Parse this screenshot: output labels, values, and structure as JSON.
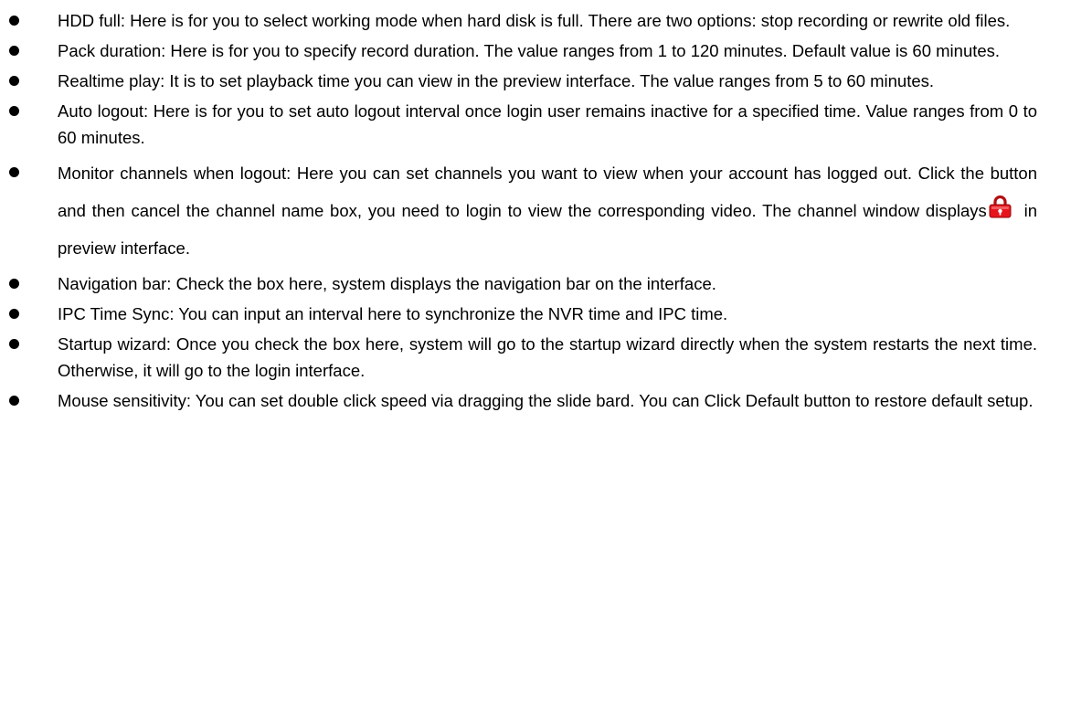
{
  "items": [
    {
      "name": "hdd-full",
      "text": "HDD full: Here is for you to select working mode when hard disk is full. There are two options: stop recording or rewrite old files."
    },
    {
      "name": "pack-duration",
      "text": "Pack duration: Here is for you to specify record duration. The value ranges from 1 to 120 minutes. Default value is 60 minutes."
    },
    {
      "name": "realtime-play",
      "text": "Realtime play: It is to set playback time you can view in the preview interface. The value ranges from 5 to 60 minutes."
    },
    {
      "name": "auto-logout",
      "text": "Auto logout: Here is for you to set auto logout interval once login user remains inactive for a specified time. Value ranges from 0 to 60 minutes."
    },
    {
      "name": "monitor-channels",
      "text_before_icon": "Monitor channels when logout: Here you can set channels you want to view when your account has logged out. Click the button and then cancel the channel name box, you need to login to view the corresponding video. The channel window displays",
      "icon": "lock-icon",
      "text_after_icon": " in preview interface."
    },
    {
      "name": "navigation-bar",
      "text": "Navigation bar: Check the box here, system displays the navigation bar on the interface."
    },
    {
      "name": "ipc-time-sync",
      "text": "IPC Time Sync: You can input an interval here to synchronize the NVR time and IPC time."
    },
    {
      "name": "startup-wizard",
      "text": "Startup wizard: Once you check the box here, system will go to the startup wizard directly when the system restarts the next time. Otherwise, it will go to the login interface."
    },
    {
      "name": "mouse-sensitivity",
      "text": "Mouse sensitivity: You can set double click speed via dragging the slide bard. You can Click Default button to restore default setup."
    }
  ],
  "colors": {
    "text": "#000000",
    "lock_icon": "#e8141c"
  }
}
